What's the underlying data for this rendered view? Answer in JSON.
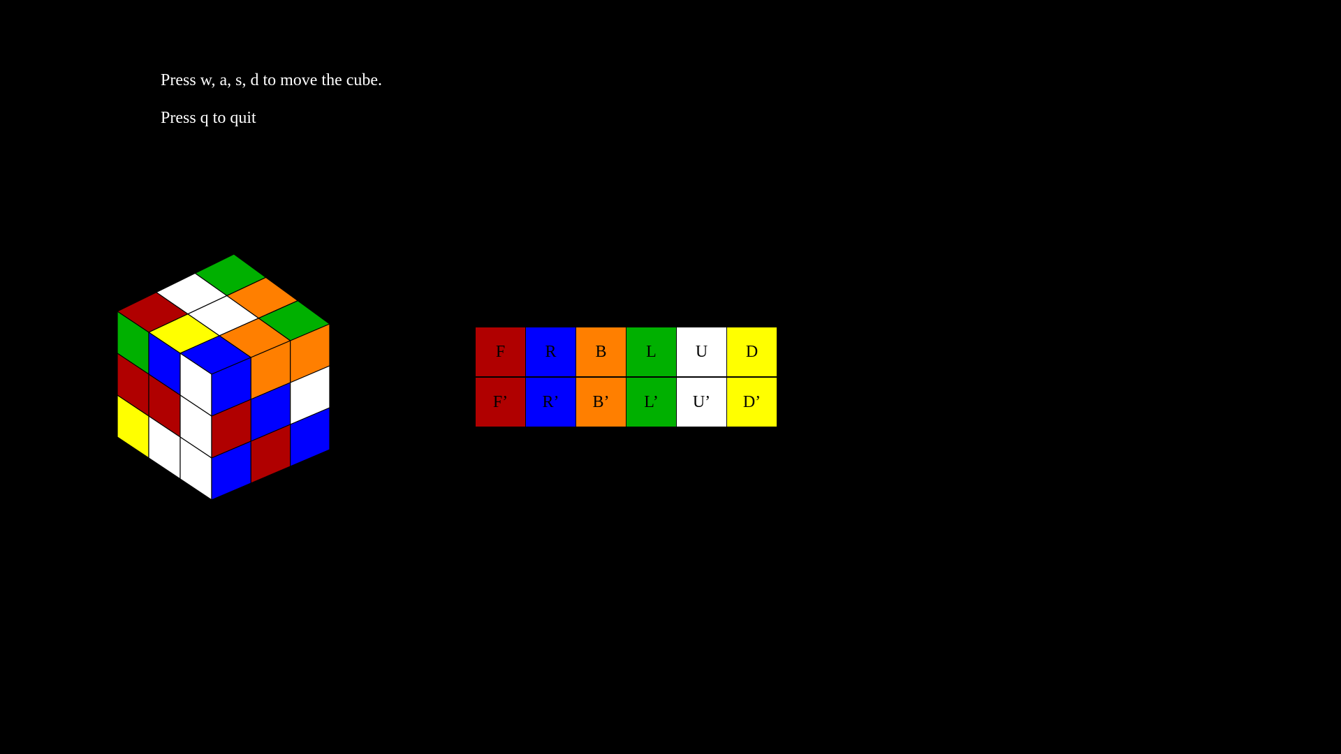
{
  "instructions": {
    "move_text": "Press w, a, s, d to move the cube.",
    "quit_text": "Press q to quit"
  },
  "colors": {
    "background": "#000000",
    "red": "#b00000",
    "blue": "#0000ff",
    "orange": "#ff7f00",
    "green": "#00b000",
    "white": "#ffffff",
    "yellow": "#ffff00",
    "sticker_border": "#000000"
  },
  "cube": {
    "top_face": [
      [
        "green",
        "orange",
        "green"
      ],
      [
        "white",
        "white",
        "orange"
      ],
      [
        "red",
        "yellow",
        "blue"
      ]
    ],
    "left_face": [
      [
        "green",
        "blue",
        "white"
      ],
      [
        "red",
        "red",
        "white"
      ],
      [
        "yellow",
        "white",
        "white"
      ]
    ],
    "right_face": [
      [
        "blue",
        "orange",
        "orange"
      ],
      [
        "red",
        "blue",
        "white"
      ],
      [
        "blue",
        "red",
        "blue"
      ]
    ],
    "top_face_extra": "orange"
  },
  "moves": [
    {
      "label": "F",
      "color": "red"
    },
    {
      "label": "R",
      "color": "blue"
    },
    {
      "label": "B",
      "color": "orange"
    },
    {
      "label": "L",
      "color": "green"
    },
    {
      "label": "U",
      "color": "white"
    },
    {
      "label": "D",
      "color": "yellow"
    },
    {
      "label": "F’",
      "color": "red"
    },
    {
      "label": "R’",
      "color": "blue"
    },
    {
      "label": "B’",
      "color": "orange"
    },
    {
      "label": "L’",
      "color": "green"
    },
    {
      "label": "U’",
      "color": "white"
    },
    {
      "label": "D’",
      "color": "yellow"
    }
  ]
}
